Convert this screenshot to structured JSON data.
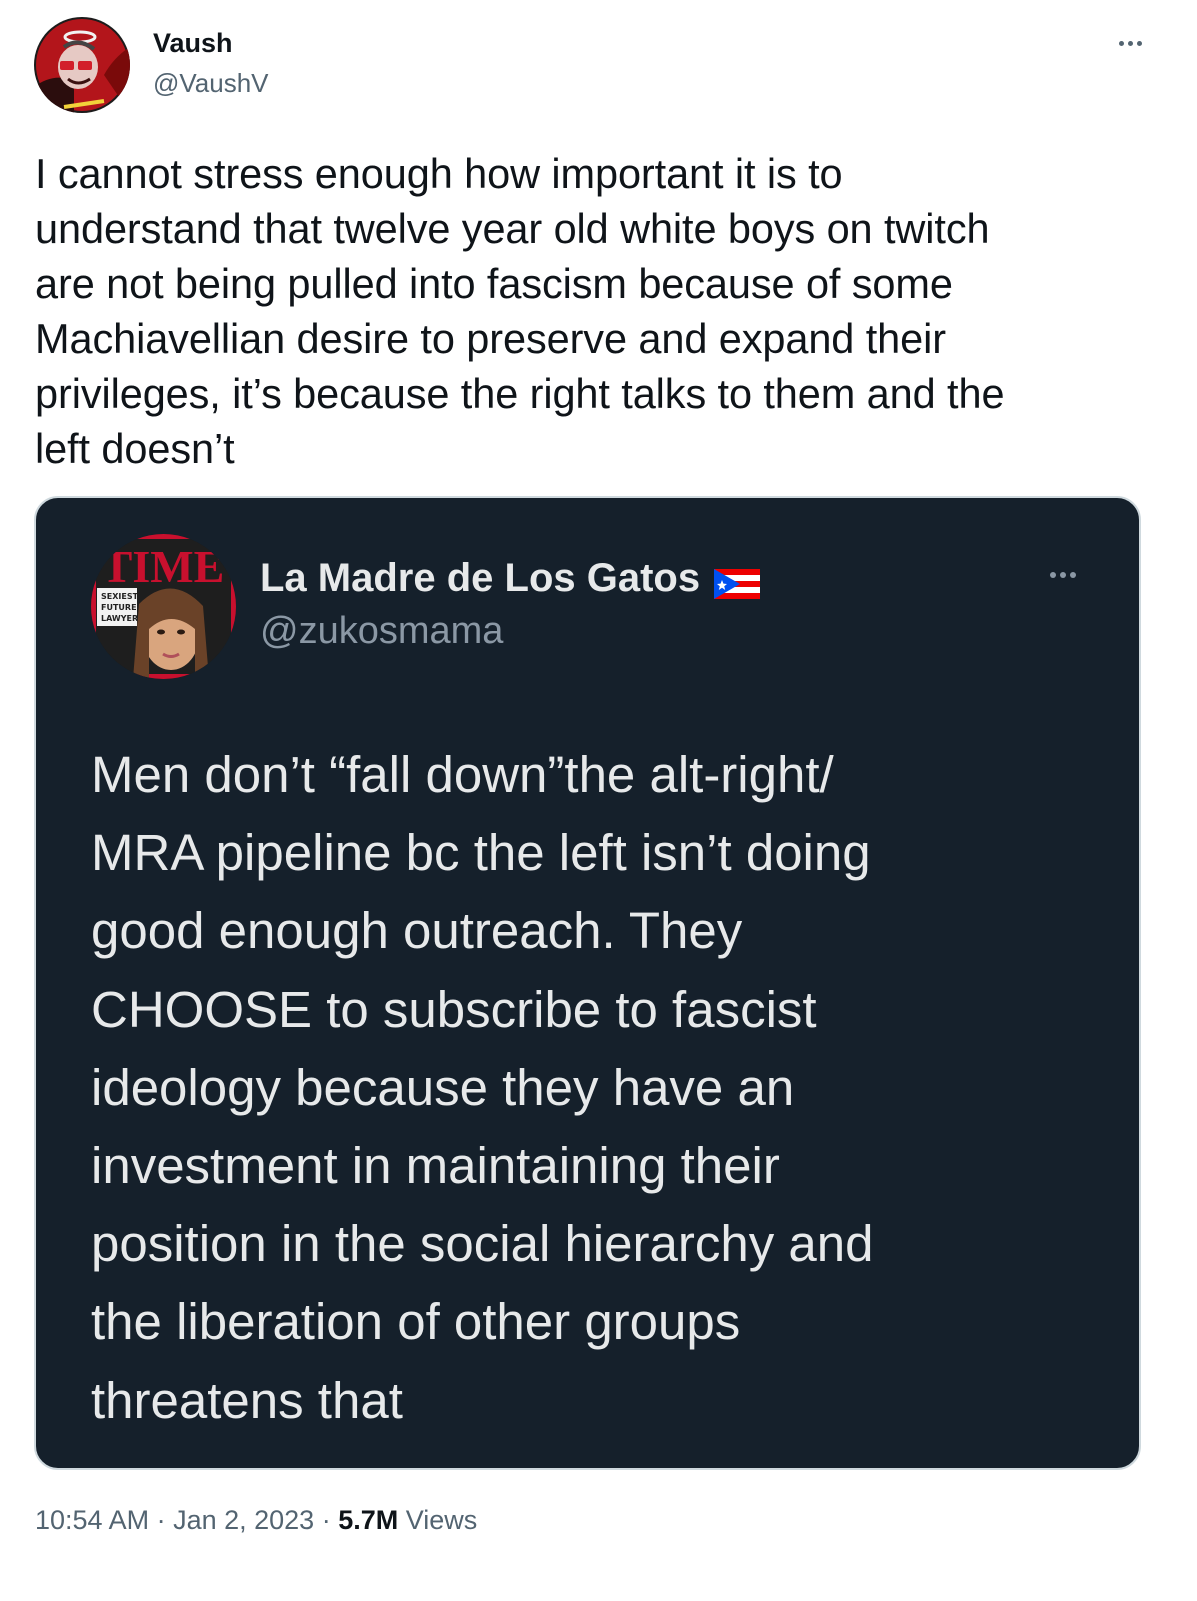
{
  "author": {
    "name": "Vaush",
    "handle": "@VaushV"
  },
  "tweet": {
    "text": "I cannot stress enough how important it is to\nunderstand that twelve year old white boys on twitch\nare not being pulled into fascism because of some\nMachiavellian desire to preserve and expand their\nprivileges, it’s because the right talks to them and the\nleft doesn’t"
  },
  "quoted": {
    "name": "La Madre de Los Gatos",
    "handle": "@zukosmama",
    "avatar_text": {
      "masthead": "TIME",
      "cover_lines": [
        "SEXIEST",
        "FUTURE",
        "LAWYER"
      ]
    },
    "text": "Men don’t “fall down”the alt-right/\nMRA pipeline bc the left isn’t doing\ngood enough outreach. They\nCHOOSE to subscribe to fascist\nideology because they have an\ninvestment in maintaining their\nposition in the social hierarchy and\nthe liberation of other groups\nthreatens that"
  },
  "meta": {
    "time": "10:54 AM",
    "sep1": " · ",
    "date": "Jan 2, 2023",
    "sep2": " · ",
    "views_count": "5.7M",
    "views_label": " Views"
  },
  "icons": {
    "more": "more-icon",
    "flag": "puerto-rico-flag-icon"
  },
  "colors": {
    "quote_bg": "#15202b",
    "secondary_text": "#536471",
    "time_cover_red": "#c8102e"
  }
}
